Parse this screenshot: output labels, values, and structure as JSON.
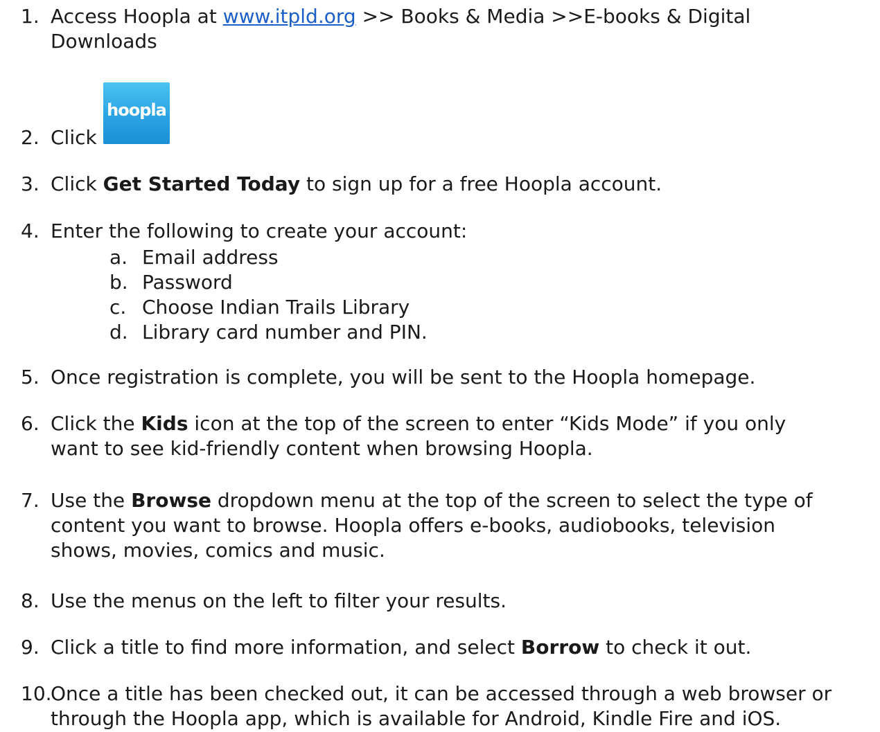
{
  "steps": [
    {
      "num": "1.",
      "line1_before": "Access Hoopla at ",
      "link": "www.itpld.org",
      "line1_after": " >> Books & Media >>E-books & Digital",
      "line2": "Downloads"
    },
    {
      "num": "2.",
      "text": "Click",
      "logo_text": "hoopla"
    },
    {
      "num": "3.",
      "before": "Click ",
      "bold": "Get Started Today",
      "after": " to sign up for a free Hoopla account."
    },
    {
      "num": "4.",
      "text": "Enter the following to create your account:",
      "sub_items": [
        {
          "letter": "a.",
          "text": "Email address"
        },
        {
          "letter": "b.",
          "text": "Password"
        },
        {
          "letter": "c.",
          "text": "Choose Indian Trails Library"
        },
        {
          "letter": "d.",
          "text": "Library card number and PIN."
        }
      ]
    },
    {
      "num": "5.",
      "text": "Once registration is complete, you will be sent to the Hoopla homepage."
    },
    {
      "num": "6.",
      "before": "Click the ",
      "bold": "Kids",
      "after": " icon at the top of the screen to enter “Kids Mode” if you only",
      "line2": "want to see kid-friendly content when browsing Hoopla."
    },
    {
      "num": "7.",
      "before": "Use the ",
      "bold": "Browse",
      "after": " dropdown menu at the top of the screen to select the type of",
      "line2": "content you want to browse. Hoopla offers e-books, audiobooks, television",
      "line3": "shows, movies, comics and music."
    },
    {
      "num": "8.",
      "text": "Use the menus on the left to filter your results."
    },
    {
      "num": "9.",
      "before": "Click a title to find more information, and select ",
      "bold": "Borrow",
      "after": " to check it out."
    },
    {
      "num": "10.",
      "line1": "Once a title has been checked out, it can be accessed through a web browser or",
      "line2": "through the Hoopla app, which is available for Android, Kindle Fire and iOS."
    }
  ],
  "colors": {
    "text": "#1a1a1a",
    "link": "#1a5fc7",
    "logo_bg": "#2aa3e3",
    "logo_text": "#ffffff"
  }
}
